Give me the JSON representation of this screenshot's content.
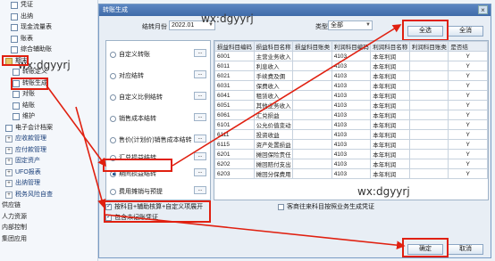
{
  "nav": {
    "items": [
      {
        "label": "凭证",
        "icon": "doc"
      },
      {
        "label": "出纳",
        "icon": "doc"
      },
      {
        "label": "现金流量表",
        "icon": "doc"
      },
      {
        "label": "账表",
        "icon": "doc"
      },
      {
        "label": "综合辅助账",
        "icon": "doc"
      },
      {
        "label": "期末",
        "icon": "fold"
      },
      {
        "label": "转账定义",
        "icon": "doc"
      },
      {
        "label": "转账生成",
        "icon": "doc"
      },
      {
        "label": "对账",
        "icon": "doc"
      },
      {
        "label": "结账",
        "icon": "doc"
      },
      {
        "label": "维护",
        "icon": "doc"
      },
      {
        "label": "电子会计档案",
        "icon": "doc"
      },
      {
        "label": "应收款管理",
        "icon": "plus"
      },
      {
        "label": "应付款管理",
        "icon": "plus"
      },
      {
        "label": "固定资产",
        "icon": "plus"
      },
      {
        "label": "UFO报表",
        "icon": "plus"
      },
      {
        "label": "出纳管理",
        "icon": "plus"
      },
      {
        "label": "税务风险自查",
        "icon": "plus"
      },
      {
        "label": "供应链",
        "icon": "none"
      },
      {
        "label": "人力资源",
        "icon": "none"
      },
      {
        "label": "内部控制",
        "icon": "none"
      },
      {
        "label": "集团应用",
        "icon": "none"
      }
    ]
  },
  "dialog": {
    "title": "转账生成",
    "close": "×",
    "period_label": "结转月份",
    "period_value": "2022.01",
    "type_label": "类型",
    "type_value": "全部",
    "select_all": "全选",
    "deselect_all": "全消",
    "ok": "确定",
    "cancel": "取消"
  },
  "watermarks": [
    "wx:dgyyrj",
    "wx:dgyyrj",
    "wx:dgyyrj"
  ],
  "options": [
    {
      "label": "自定义转账",
      "checked": false
    },
    {
      "label": "对应结转",
      "checked": false
    },
    {
      "label": "自定义比例结转",
      "checked": false
    },
    {
      "label": "销售成本结转",
      "checked": false
    },
    {
      "label": "售价(计划价)销售成本结转",
      "checked": false
    },
    {
      "label": "汇兑损益结转",
      "checked": false
    },
    {
      "label": "期间损益结转",
      "checked": true
    },
    {
      "label": "费用摊销与预提",
      "checked": false
    }
  ],
  "mini_button": "...",
  "grid": {
    "columns": [
      "损益科目编码",
      "损益科目名称",
      "损益科目账类",
      "利润科目编码",
      "利润科目名称",
      "利润科目账类",
      "是否结"
    ],
    "rows": [
      [
        "6001",
        "主营业务收入",
        "",
        "4103",
        "本年利润",
        "",
        "Y"
      ],
      [
        "6011",
        "利息收入",
        "",
        "4103",
        "本年利润",
        "",
        "Y"
      ],
      [
        "6021",
        "手续费及佣",
        "",
        "4103",
        "本年利润",
        "",
        "Y"
      ],
      [
        "6031",
        "保费收入",
        "",
        "4103",
        "本年利润",
        "",
        "Y"
      ],
      [
        "6041",
        "租赁收入",
        "",
        "4103",
        "本年利润",
        "",
        "Y"
      ],
      [
        "6051",
        "其他业务收入",
        "",
        "4103",
        "本年利润",
        "",
        "Y"
      ],
      [
        "6061",
        "汇兑损益",
        "",
        "4103",
        "本年利润",
        "",
        "Y"
      ],
      [
        "6101",
        "公允价值变动",
        "",
        "4103",
        "本年利润",
        "",
        "Y"
      ],
      [
        "6111",
        "投资收益",
        "",
        "4103",
        "本年利润",
        "",
        "Y"
      ],
      [
        "6115",
        "资产处置损益",
        "",
        "4103",
        "本年利润",
        "",
        "Y"
      ],
      [
        "6201",
        "摊回保险责任",
        "",
        "4103",
        "本年利润",
        "",
        "Y"
      ],
      [
        "6202",
        "摊回赔付支出",
        "",
        "4103",
        "本年利润",
        "",
        "Y"
      ],
      [
        "6203",
        "摊回分保费用",
        "",
        "4103",
        "本年利润",
        "",
        "Y"
      ]
    ]
  },
  "checkboxes": {
    "by_subject": {
      "label": "按科目+辅助核算+自定义项展开",
      "checked": true
    },
    "include_unposted": {
      "label": "包含未记账凭证",
      "checked": true
    },
    "external_voucher": {
      "label": "客商往来科目按照业务生成凭证",
      "checked": false
    }
  }
}
